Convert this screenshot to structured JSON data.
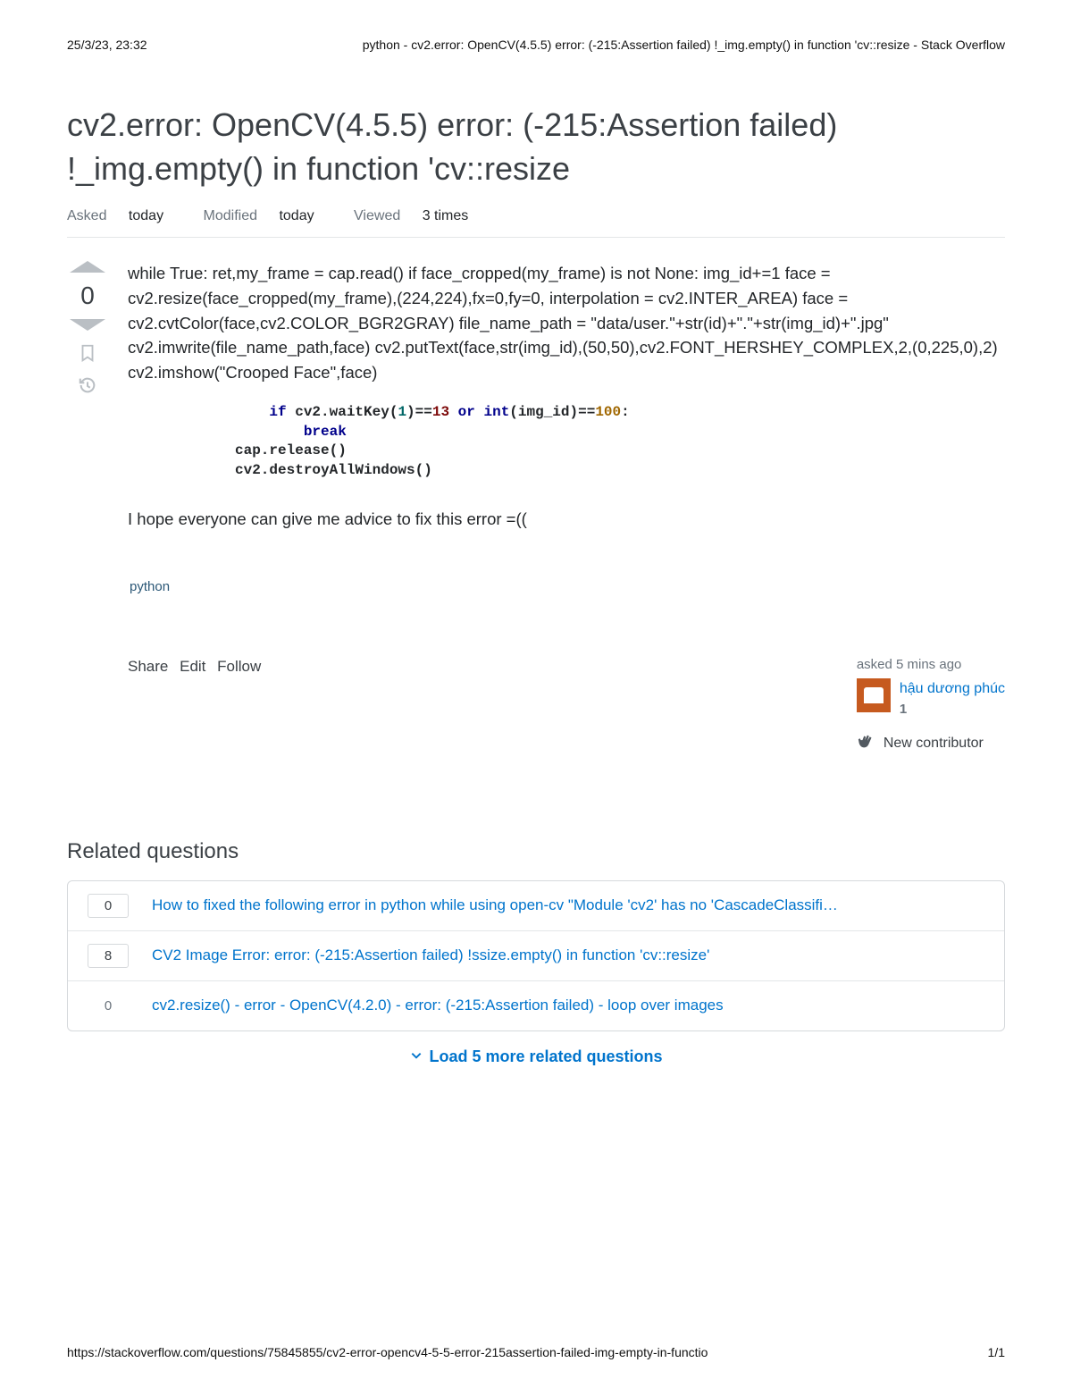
{
  "print": {
    "timestamp": "25/3/23, 23:32",
    "header_title": "python - cv2.error: OpenCV(4.5.5) error: (-215:Assertion failed) !_img.empty() in function 'cv::resize - Stack Overflow",
    "footer_url": "https://stackoverflow.com/questions/75845855/cv2-error-opencv4-5-5-error-215assertion-failed-img-empty-in-functio",
    "footer_page": "1/1"
  },
  "question": {
    "title": "cv2.error: OpenCV(4.5.5) error: (-215:Assertion failed) !_img.empty() in function 'cv::resize",
    "meta": {
      "asked_label": "Asked",
      "asked_value": "today",
      "modified_label": "Modified",
      "modified_value": "today",
      "viewed_label": "Viewed",
      "viewed_value": "3 times"
    },
    "body": {
      "para1": "while True: ret,my_frame = cap.read() if face_cropped(my_frame) is not None: img_id+=1 face = cv2.resize(face_cropped(my_frame),(224,224),fx=0,fy=0, interpolation = cv2.INTER_AREA) face = cv2.cvtColor(face,cv2.COLOR_BGR2GRAY) file_name_path = \"data/user.\"+str(id)+\".\"+str(img_id)+\".jpg\" cv2.imwrite(file_name_path,face) cv2.putText(face,str(img_id),(50,50),cv2.FONT_HERSHEY_COMPLEX,2,(0,225,0),2) cv2.imshow(\"Crooped Face\",face)",
      "para2": "I hope everyone can give me advice to fix this error =(("
    },
    "code": {
      "if": "if",
      "part1": " cv2.waitKey(",
      "n1": "1",
      "part2": ")==",
      "n13": "13",
      "or": "or",
      "int": "int",
      "part3": "(img_id)==",
      "n100": "100",
      "colon": ":",
      "break": "break",
      "line3": "cap.release()",
      "line4": "cv2.destroyAllWindows()"
    },
    "vote": {
      "count": "0"
    },
    "tags": [
      "python"
    ],
    "actions": {
      "share": "Share",
      "edit": "Edit",
      "follow": "Follow"
    },
    "owner": {
      "asked": "asked 5 mins ago",
      "name": "hậu dương phúc",
      "rep": "1",
      "new_contributor": "New contributor"
    }
  },
  "related": {
    "title": "Related questions",
    "items": [
      {
        "score": "0",
        "bordered": true,
        "title": "How to fixed the following error in python while using open-cv \"Module 'cv2' has no 'CascadeClassifi…"
      },
      {
        "score": "8",
        "bordered": true,
        "title": "CV2 Image Error: error: (-215:Assertion failed) !ssize.empty() in function 'cv::resize'"
      },
      {
        "score": "0",
        "bordered": false,
        "title": "cv2.resize() - error - OpenCV(4.2.0) - error: (-215:Assertion failed) - loop over images"
      }
    ],
    "load_more": "Load 5 more related questions"
  }
}
